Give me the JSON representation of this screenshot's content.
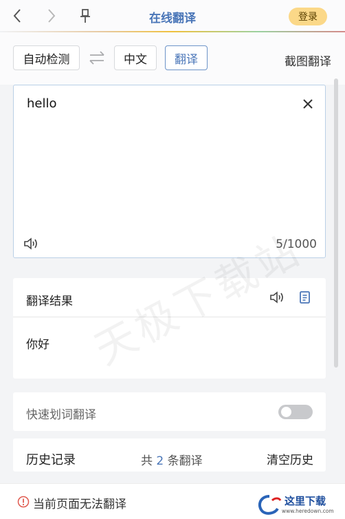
{
  "header": {
    "title": "在线翻译",
    "login_label": "登录"
  },
  "toolbar": {
    "source_lang": "自动检测",
    "target_lang": "中文",
    "translate_label": "翻译",
    "screenshot_label": "截图翻译"
  },
  "input": {
    "text": "hello",
    "char_count": "5/1000"
  },
  "result": {
    "title": "翻译结果",
    "text": "你好"
  },
  "quick": {
    "label": "快速划词翻译",
    "enabled": false
  },
  "history": {
    "title": "历史记录",
    "count_prefix": "共",
    "count": "2",
    "count_suffix": "条翻译",
    "clear_label": "清空历史"
  },
  "footer": {
    "message": "当前页面无法翻译",
    "logo_text": "这里下载",
    "logo_url": "www.heredown.com"
  },
  "watermark": "天极下载站",
  "icons": {
    "back": "chevron-left-icon",
    "forward": "chevron-right-icon",
    "pin": "pin-icon",
    "swap": "swap-icon",
    "clear": "close-icon",
    "speaker": "speaker-icon",
    "copy": "copy-icon",
    "warning": "warning-circle-icon"
  },
  "colors": {
    "accent": "#4a76b8",
    "login_bg": "#fbd888",
    "warning": "#e05a4f"
  }
}
